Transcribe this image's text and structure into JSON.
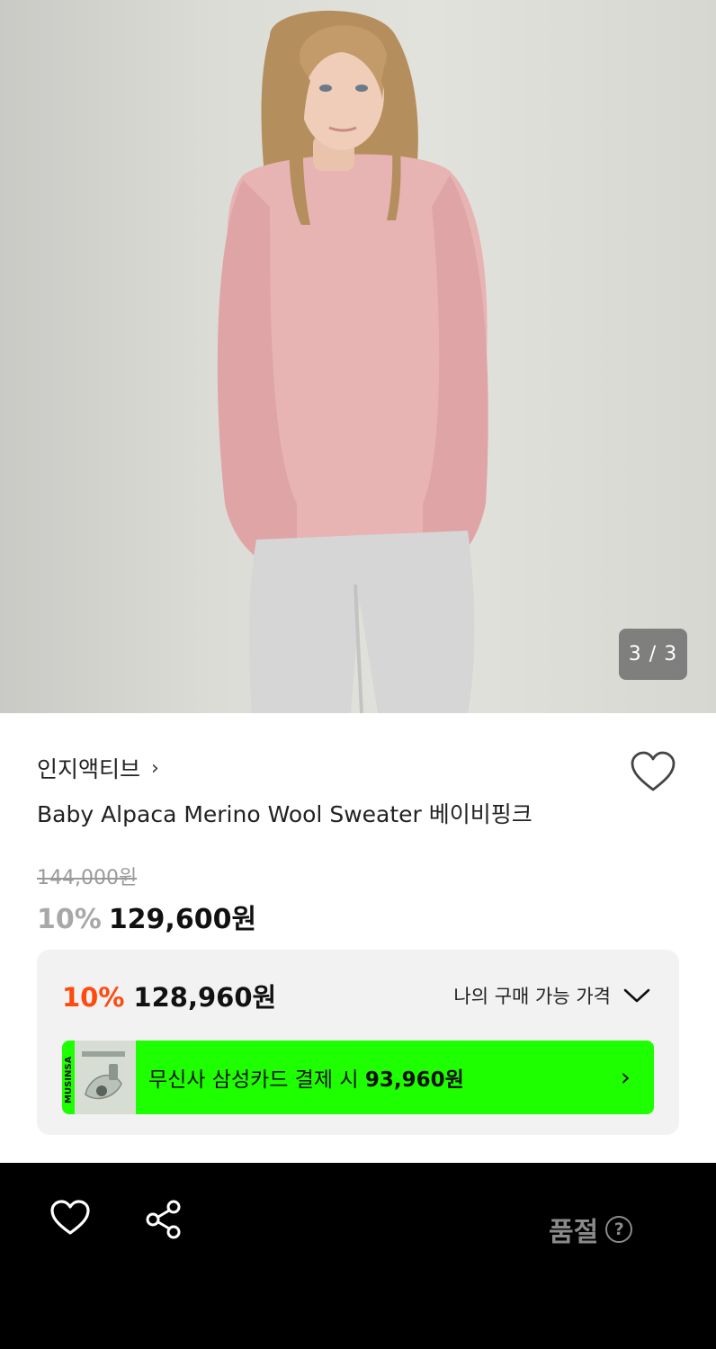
{
  "gallery": {
    "counter": "3 / 3",
    "image_alt": "model wearing pink knit sweater and grey sweatpants"
  },
  "product": {
    "brand": "인지액티브",
    "brand_chevron": "›",
    "title": "Baby Alpaca Merino Wool Sweater 베이비핑크",
    "original_price": "144,000원",
    "discount_pct": "10%",
    "price": "129,600원"
  },
  "member_price": {
    "discount_pct": "10%",
    "price": "128,960원",
    "toggle_label": "나의 구매 가능 가격"
  },
  "promo": {
    "text_prefix": "무신사 삼성카드 결제 시 ",
    "text_price": "93,960원",
    "arrow": "›",
    "card_brand": "MUSINSA"
  },
  "bottom_bar": {
    "status": "품절",
    "help": "?"
  },
  "colors": {
    "discount_orange": "#ff4a0f",
    "promo_green": "#1eff00",
    "bottom_bg": "#000000"
  },
  "icons": [
    "heart-outline-icon",
    "chevron-down-icon",
    "chevron-right-icon",
    "share-icon",
    "question-circle-icon"
  ]
}
